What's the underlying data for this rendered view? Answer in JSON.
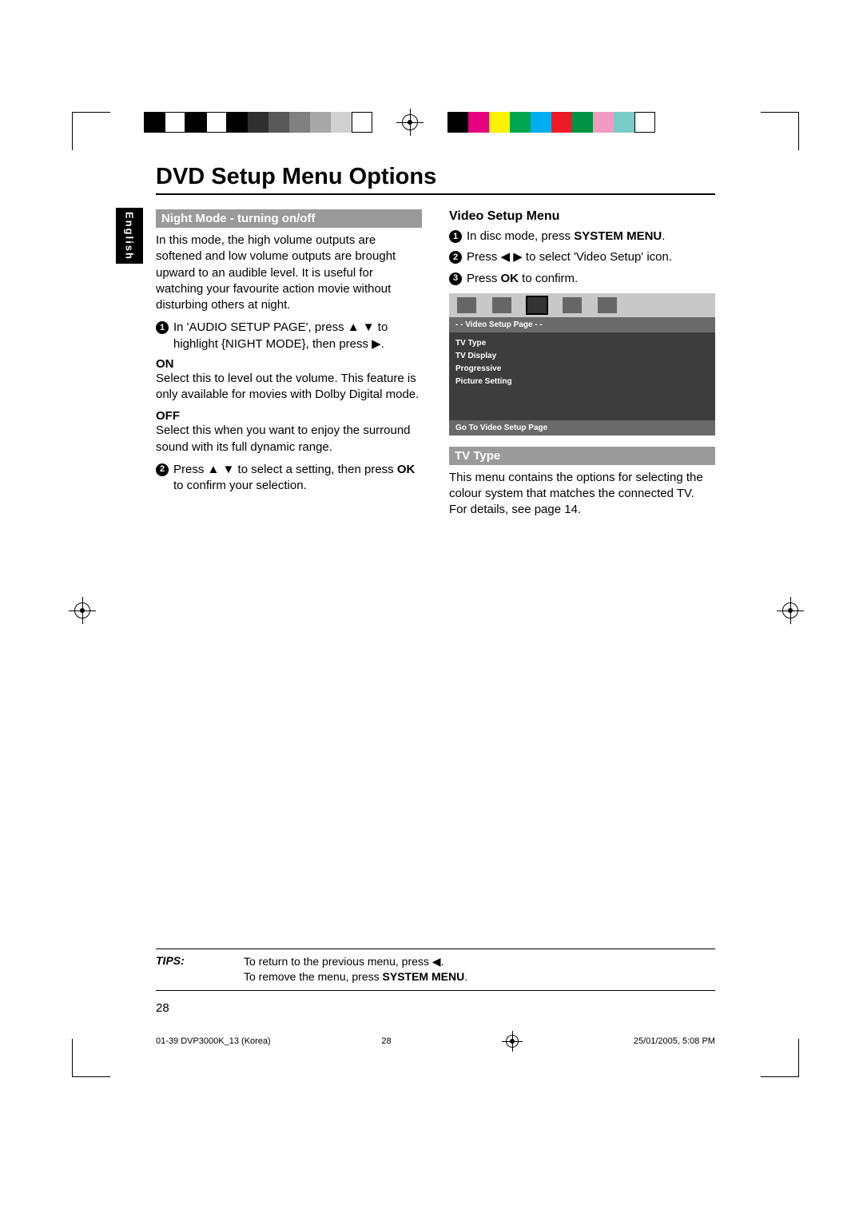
{
  "lang_tab": "English",
  "title": "DVD Setup Menu Options",
  "left": {
    "bar": "Night Mode - turning on/off",
    "intro": "In this mode, the high volume outputs are softened and low volume outputs are brought upward to an audible level. It is useful for watching your favourite action movie without disturbing others at night.",
    "step1_a": "In 'AUDIO SETUP PAGE', press ",
    "step1_b": " to highlight {NIGHT MODE}, then press ",
    "on_head": "ON",
    "on_text": "Select this to level out the volume. This feature is only available for movies with Dolby Digital mode.",
    "off_head": "OFF",
    "off_text": "Select this when you want to enjoy the surround sound with its full dynamic range.",
    "step2_a": "Press ",
    "step2_b": " to select a setting, then press ",
    "step2_ok": "OK",
    "step2_c": " to confirm your selection."
  },
  "right": {
    "heading": "Video Setup Menu",
    "s1_a": "In disc mode, press ",
    "s1_b": "SYSTEM MENU",
    "s1_c": ".",
    "s2_a": "Press ",
    "s2_b": " to select 'Video Setup' icon.",
    "s3_a": "Press ",
    "s3_ok": "OK",
    "s3_b": " to confirm.",
    "osd": {
      "header": "- -   Video Setup Page   - -",
      "items": [
        "TV Type",
        "TV Display",
        "Progressive",
        "Picture Setting"
      ],
      "footer": "Go To Video Setup Page"
    },
    "tvtype_bar": "TV Type",
    "tvtype_text": "This menu contains the options for selecting the colour system that matches the connected TV.  For details, see page 14."
  },
  "tips": {
    "label": "TIPS:",
    "line1_a": "To return to the previous menu, press ",
    "line1_b": ".",
    "line2_a": "To remove the menu, press ",
    "line2_b": "SYSTEM MENU",
    "line2_c": "."
  },
  "page_number": "28",
  "footer": {
    "left": "01-39 DVP3000K_13 (Korea)",
    "center": "28",
    "right": "25/01/2005, 5:08 PM"
  },
  "colorbars": {
    "left": [
      "#000",
      "#fff",
      "#000",
      "#fff",
      "#000",
      "#303030",
      "#585858",
      "#808080",
      "#a8a8a8",
      "#d0d0d0",
      "#ffffff"
    ],
    "right": [
      "#000",
      "#e5007e",
      "#fff200",
      "#00a651",
      "#00aeef",
      "#ed1c24",
      "#009444",
      "#f49ac1",
      "#7accc8",
      "#fff"
    ]
  }
}
